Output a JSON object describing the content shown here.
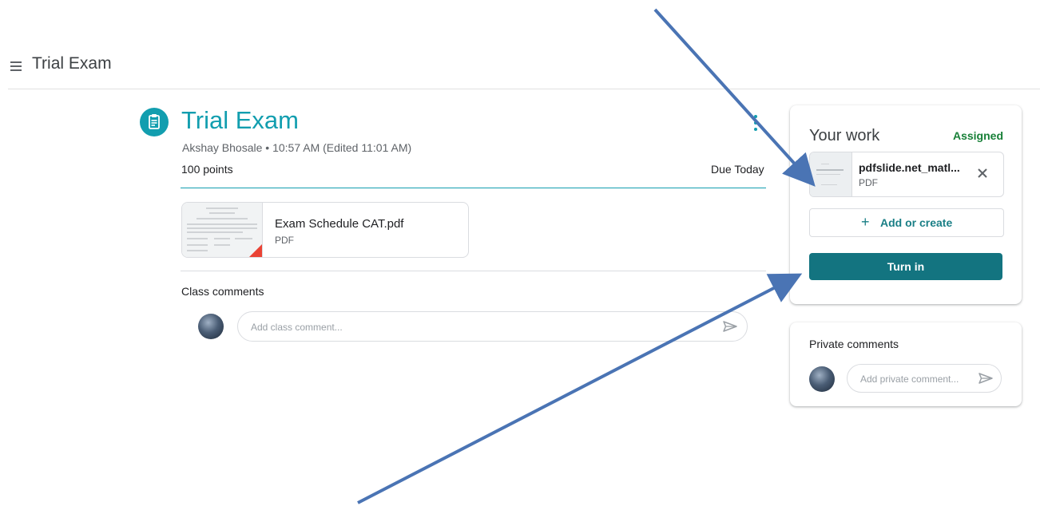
{
  "header": {
    "title": "Trial Exam"
  },
  "assignment": {
    "title": "Trial Exam",
    "meta": "Akshay Bhosale • 10:57 AM (Edited 11:01 AM)",
    "points": "100 points",
    "due": "Due Today",
    "attachment": {
      "name": "Exam Schedule CAT.pdf",
      "type": "PDF"
    }
  },
  "class_comments": {
    "label": "Class comments",
    "placeholder": "Add class comment..."
  },
  "your_work": {
    "title": "Your work",
    "status": "Assigned",
    "file": {
      "name": "pdfslide.net_matl...",
      "type": "PDF"
    },
    "add_label": "Add or create",
    "turn_in_label": "Turn in"
  },
  "private_comments": {
    "label": "Private comments",
    "placeholder": "Add private comment..."
  },
  "colors": {
    "accent_teal": "#129eaf",
    "button_teal": "#137480",
    "status_green": "#188038",
    "pdf_red": "#ea4335",
    "arrow_blue": "#4a74b4"
  }
}
